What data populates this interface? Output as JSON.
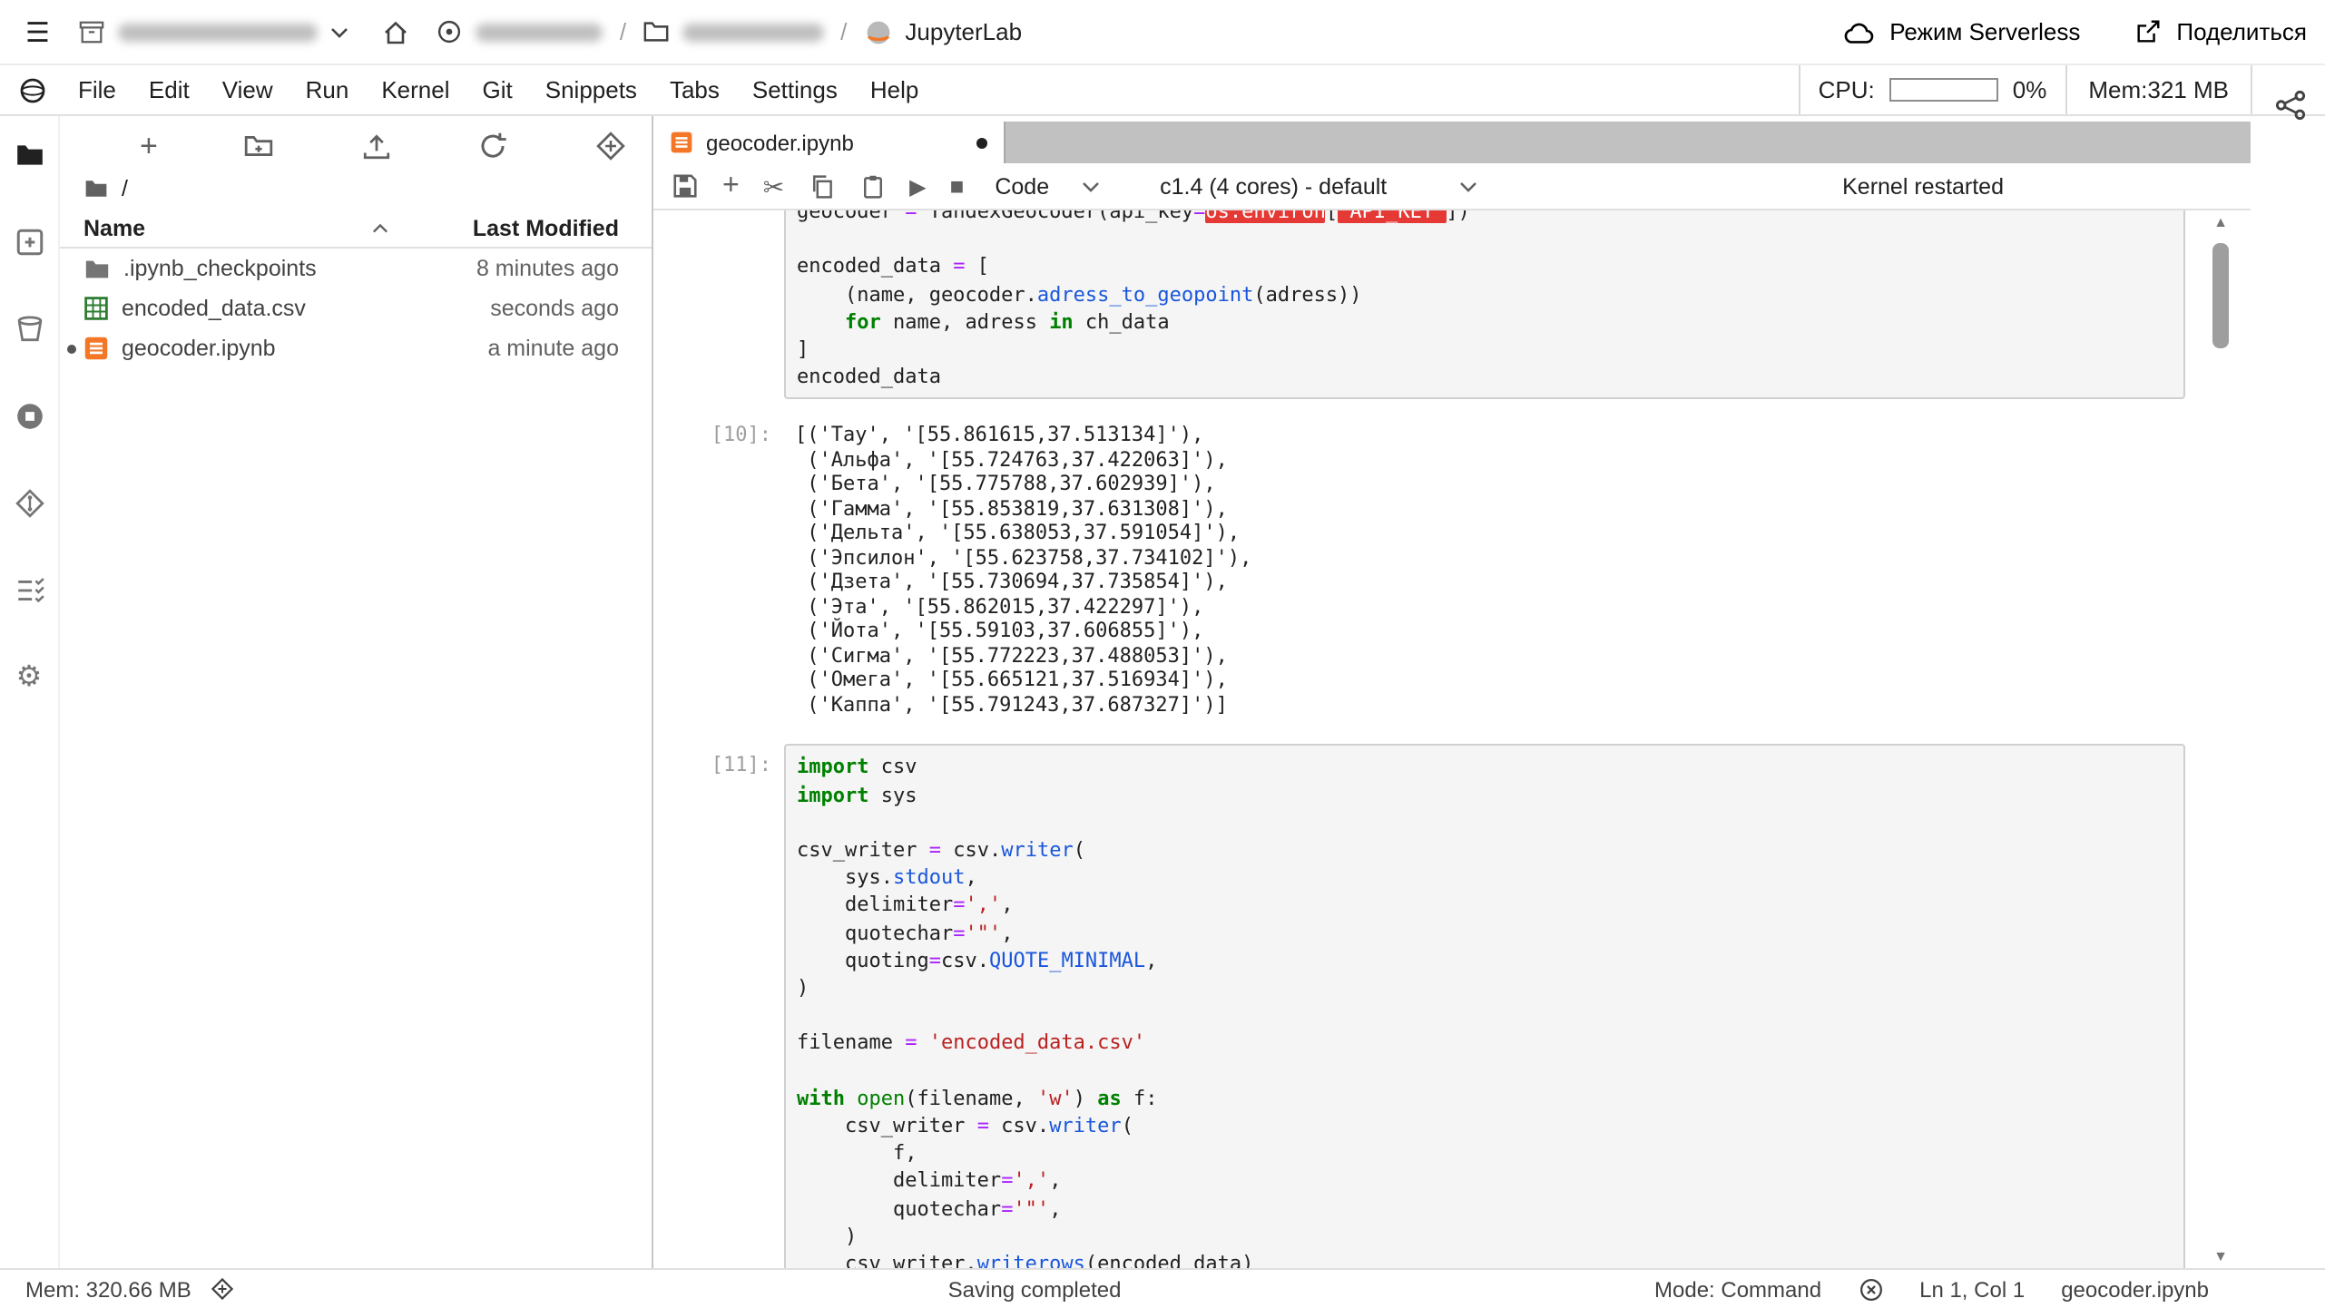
{
  "topbar": {
    "jupyterlab_label": "JupyterLab",
    "serverless_label": "Режим Serverless",
    "share_label": "Поделиться"
  },
  "menubar": {
    "items": [
      "File",
      "Edit",
      "View",
      "Run",
      "Kernel",
      "Git",
      "Snippets",
      "Tabs",
      "Settings",
      "Help"
    ],
    "cpu_label": "CPU:",
    "cpu_percent": "0%",
    "mem_label": "Mem:321 MB"
  },
  "filebrowser": {
    "breadcrumb_root": "/",
    "columns": {
      "name": "Name",
      "modified": "Last Modified"
    },
    "files": [
      {
        "name": ".ipynb_checkpoints",
        "modified": "8 minutes ago"
      },
      {
        "name": "encoded_data.csv",
        "modified": "seconds ago"
      },
      {
        "name": "geocoder.ipynb",
        "modified": "a minute ago"
      }
    ]
  },
  "main": {
    "tab": {
      "label": "geocoder.ipynb"
    },
    "toolbar": {
      "cell_type": "Code",
      "kernel": "c1.4 (4 cores) - default",
      "status": "Kernel restarted"
    }
  },
  "icons": {
    "hamburger": "☰",
    "scissors": "✂",
    "play": "▶",
    "stop": "■",
    "plus": "+",
    "gear": "⚙",
    "caret_up": "▲",
    "arrow_up": "▲",
    "arrow_down": "▼"
  },
  "notebook": {
    "cells": [
      {
        "kind": "code",
        "prompt": "",
        "clip": -17,
        "lines": [
          [
            [
              "p",
              "geocoder "
            ],
            [
              "o",
              "="
            ],
            [
              "p",
              " YandexGeocoder(api_key"
            ],
            [
              "o",
              "="
            ],
            [
              "rd",
              "os.environ"
            ],
            [
              "p",
              "["
            ],
            [
              "rd",
              "'API_KEY'"
            ],
            [
              "p",
              "])"
            ]
          ],
          [],
          [
            [
              "p",
              "encoded_data "
            ],
            [
              "o",
              "="
            ],
            [
              "p",
              " ["
            ]
          ],
          [
            [
              "p",
              "    (name, geocoder."
            ],
            [
              "b",
              "adress_to_geopoint"
            ],
            [
              "p",
              "(adress))"
            ]
          ],
          [
            [
              "p",
              "    "
            ],
            [
              "k",
              "for"
            ],
            [
              "p",
              " name, adress "
            ],
            [
              "k",
              "in"
            ],
            [
              "p",
              " ch_data"
            ]
          ],
          [
            [
              "p",
              "]"
            ]
          ],
          [
            [
              "p",
              "encoded_data"
            ]
          ]
        ]
      },
      {
        "kind": "output",
        "prompt": "[10]:",
        "lines": [
          "[('Тау', '[55.861615,37.513134]'),",
          " ('Альфа', '[55.724763,37.422063]'),",
          " ('Бета', '[55.775788,37.602939]'),",
          " ('Гамма', '[55.853819,37.631308]'),",
          " ('Дельта', '[55.638053,37.591054]'),",
          " ('Эпсилон', '[55.623758,37.734102]'),",
          " ('Дзета', '[55.730694,37.735854]'),",
          " ('Эта', '[55.862015,37.422297]'),",
          " ('Йота', '[55.59103,37.606855]'),",
          " ('Сигма', '[55.772223,37.488053]'),",
          " ('Омега', '[55.665121,37.516934]'),",
          " ('Каппа', '[55.791243,37.687327]')]"
        ]
      },
      {
        "kind": "code",
        "prompt": "[11]:",
        "clip": 0,
        "lines": [
          [
            [
              "k",
              "import"
            ],
            [
              "p",
              " csv"
            ]
          ],
          [
            [
              "k",
              "import"
            ],
            [
              "p",
              " sys"
            ]
          ],
          [],
          [
            [
              "p",
              "csv_writer "
            ],
            [
              "o",
              "="
            ],
            [
              "p",
              " csv."
            ],
            [
              "b",
              "writer"
            ],
            [
              "p",
              "("
            ]
          ],
          [
            [
              "p",
              "    sys."
            ],
            [
              "b",
              "stdout"
            ],
            [
              "p",
              ","
            ]
          ],
          [
            [
              "p",
              "    delimiter"
            ],
            [
              "o",
              "="
            ],
            [
              "s",
              "','"
            ],
            [
              "p",
              ","
            ]
          ],
          [
            [
              "p",
              "    quotechar"
            ],
            [
              "o",
              "="
            ],
            [
              "s",
              "'\"'"
            ],
            [
              "p",
              ","
            ]
          ],
          [
            [
              "p",
              "    quoting"
            ],
            [
              "o",
              "="
            ],
            [
              "p",
              "csv."
            ],
            [
              "b",
              "QUOTE_MINIMAL"
            ],
            [
              "p",
              ","
            ]
          ],
          [
            [
              "p",
              ")"
            ]
          ],
          [],
          [
            [
              "p",
              "filename "
            ],
            [
              "o",
              "="
            ],
            [
              "p",
              " "
            ],
            [
              "s",
              "'encoded_data.csv'"
            ]
          ],
          [],
          [
            [
              "k",
              "with"
            ],
            [
              "p",
              " "
            ],
            [
              "g",
              "open"
            ],
            [
              "p",
              "(filename, "
            ],
            [
              "s",
              "'w'"
            ],
            [
              "p",
              ") "
            ],
            [
              "k",
              "as"
            ],
            [
              "p",
              " f:"
            ]
          ],
          [
            [
              "p",
              "    csv_writer "
            ],
            [
              "o",
              "="
            ],
            [
              "p",
              " csv."
            ],
            [
              "b",
              "writer"
            ],
            [
              "p",
              "("
            ]
          ],
          [
            [
              "p",
              "        f,"
            ]
          ],
          [
            [
              "p",
              "        delimiter"
            ],
            [
              "o",
              "="
            ],
            [
              "s",
              "','"
            ],
            [
              "p",
              ","
            ]
          ],
          [
            [
              "p",
              "        quotechar"
            ],
            [
              "o",
              "="
            ],
            [
              "s",
              "'\"'"
            ],
            [
              "p",
              ","
            ]
          ],
          [
            [
              "p",
              "    )"
            ]
          ],
          [
            [
              "p",
              "    csv_writer."
            ],
            [
              "b",
              "writerows"
            ],
            [
              "p",
              "(encoded_data)"
            ]
          ]
        ]
      }
    ]
  },
  "statusbar": {
    "mem": "Mem: 320.66 MB",
    "center": "Saving completed",
    "mode": "Mode: Command",
    "position": "Ln 1, Col 1",
    "file": "geocoder.ipynb"
  }
}
